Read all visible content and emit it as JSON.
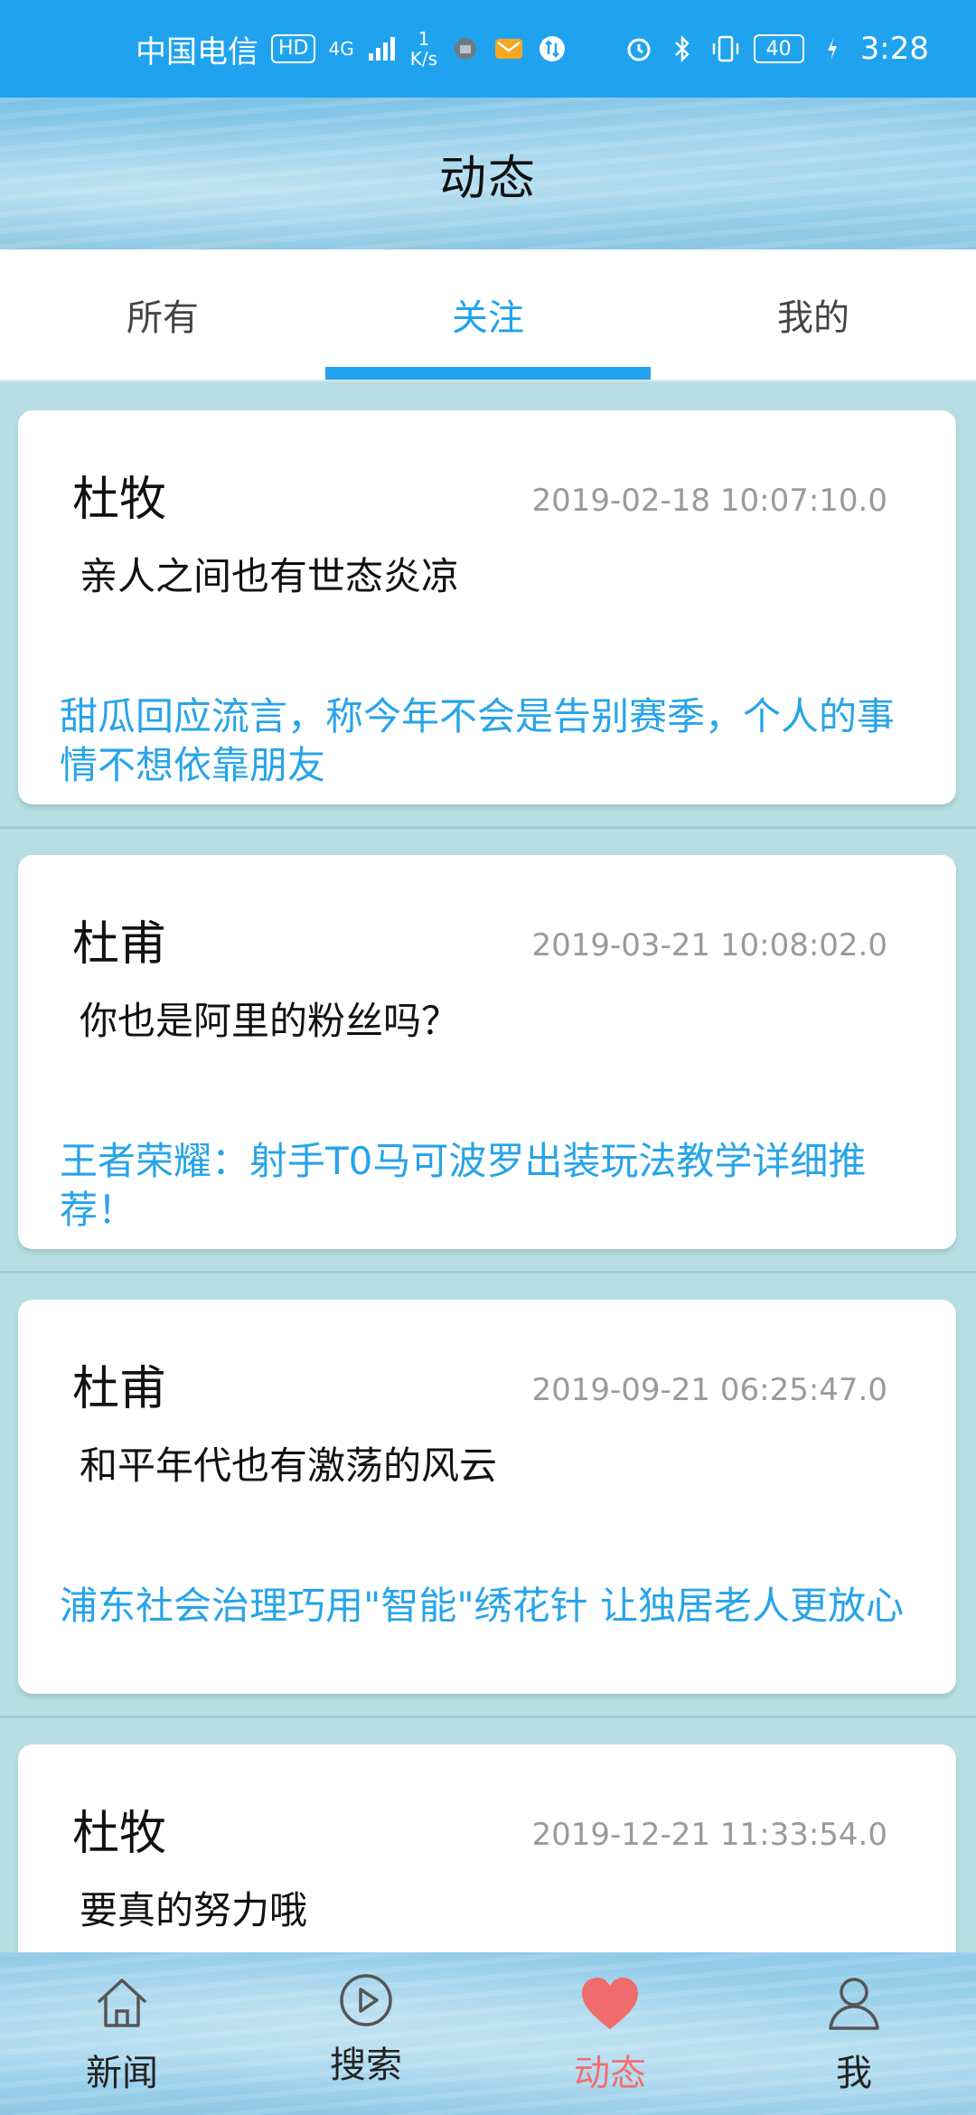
{
  "status_bar": {
    "carrier": "中国电信",
    "hd": "HD",
    "network": "4G",
    "speed_value": "1",
    "speed_unit": "K/s",
    "battery": "40",
    "time": "3:28"
  },
  "header": {
    "title": "动态"
  },
  "tabs": [
    {
      "label": "所有",
      "active": false
    },
    {
      "label": "关注",
      "active": true
    },
    {
      "label": "我的",
      "active": false
    }
  ],
  "posts": [
    {
      "author": "杜牧",
      "time": "2019-02-18 10:07:10.0",
      "content": "亲人之间也有世态炎凉",
      "news": "甜瓜回应流言，称今年不会是告别赛季，个人的事情不想依靠朋友"
    },
    {
      "author": "杜甫",
      "time": "2019-03-21 10:08:02.0",
      "content": "你也是阿里的粉丝吗？",
      "news": "王者荣耀：射手T0马可波罗出装玩法教学详细推荐！"
    },
    {
      "author": "杜甫",
      "time": "2019-09-21 06:25:47.0",
      "content": "和平年代也有激荡的风云",
      "news": "浦东社会治理巧用\"智能\"绣花针 让独居老人更放心"
    },
    {
      "author": "杜牧",
      "time": "2019-12-21 11:33:54.0",
      "content": "要真的努力哦",
      "news": ""
    }
  ],
  "bottom_nav": [
    {
      "label": "新闻",
      "icon": "home-icon",
      "active": false
    },
    {
      "label": "搜索",
      "icon": "play-icon",
      "active": false
    },
    {
      "label": "动态",
      "icon": "heart-icon",
      "active": true
    },
    {
      "label": "我",
      "icon": "person-icon",
      "active": false
    }
  ],
  "colors": {
    "accent": "#20A3EE",
    "link": "#27A4E8",
    "active_nav": "#F07070",
    "background": "#B7DFE3"
  }
}
